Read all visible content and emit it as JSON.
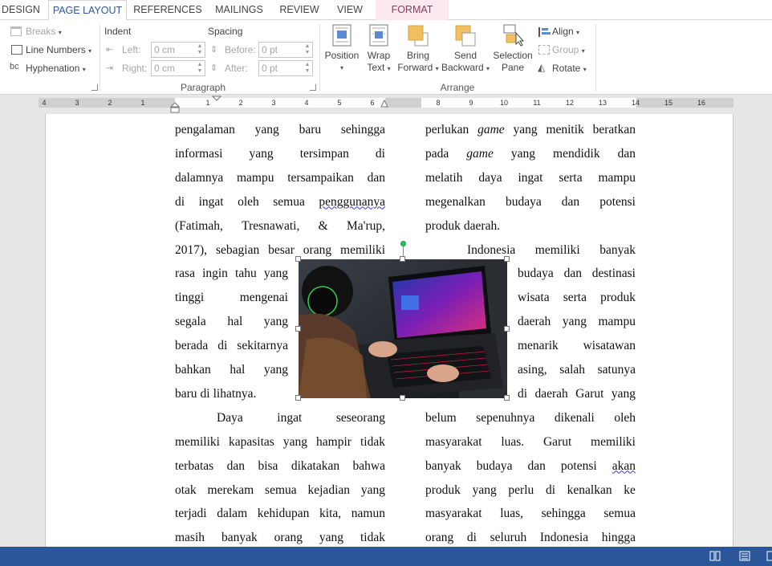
{
  "tabs": [
    {
      "label": "DESIGN"
    },
    {
      "label": "PAGE LAYOUT"
    },
    {
      "label": "REFERENCES"
    },
    {
      "label": "MAILINGS"
    },
    {
      "label": "REVIEW"
    },
    {
      "label": "VIEW"
    },
    {
      "label": "FORMAT"
    }
  ],
  "ribbon": {
    "setup": {
      "breaks": "Breaks",
      "line_numbers": "Line Numbers",
      "hyphenation": "Hyphenation"
    },
    "indent": {
      "title": "Indent",
      "left_label": "Left:",
      "left_value": "0 cm",
      "right_label": "Right:",
      "right_value": "0 cm"
    },
    "spacing": {
      "title": "Spacing",
      "before_label": "Before:",
      "before_value": "0 pt",
      "after_label": "After:",
      "after_value": "0 pt"
    },
    "paragraph_group": "Paragraph",
    "arrange": {
      "position": "Position",
      "wrap_text_1": "Wrap",
      "wrap_text_2": "Text",
      "bring_forward_1": "Bring",
      "bring_forward_2": "Forward",
      "send_backward_1": "Send",
      "send_backward_2": "Backward",
      "selection_pane_1": "Selection",
      "selection_pane_2": "Pane",
      "align": "Align",
      "group": "Group",
      "rotate": "Rotate",
      "group_label": "Arrange"
    }
  },
  "ruler": {
    "numbers": [
      "4",
      "3",
      "2",
      "1",
      "1",
      "2",
      "3",
      "4",
      "5",
      "6",
      "8",
      "9",
      "10",
      "11",
      "12",
      "13",
      "14",
      "15",
      "16"
    ]
  },
  "colors": {
    "accent": "#2b579a",
    "format_tab": "#fbe9ef",
    "rotate_handle": "#22c55e"
  },
  "document": {
    "left_column": [
      [
        "pengalaman",
        "yang",
        "baru",
        "sehingga"
      ],
      [
        "informasi",
        "yang",
        "tersimpan",
        "di"
      ],
      [
        "dalamnya",
        "mampu",
        "tersampaikan",
        "dan"
      ],
      [
        "di",
        "ingat",
        "oleh",
        "semua",
        "penggunanya"
      ],
      [
        "(Fatimah,",
        "Tresnawati,",
        "&",
        "Ma'rup,"
      ],
      [
        "2017),",
        "sebagian",
        "besar",
        "orang",
        "memiliki"
      ],
      [
        "rasa",
        "ingin",
        "tahu",
        "yang"
      ],
      [
        "tinggi",
        "mengenai"
      ],
      [
        "segala",
        "hal",
        "yang"
      ],
      [
        "berada",
        "di",
        "sekitarnya"
      ],
      [
        "bahkan",
        "hal",
        "yang"
      ],
      [
        "baru",
        "di",
        "lihatnya."
      ],
      [
        "Daya",
        "ingat",
        "seseorang"
      ],
      [
        "memiliki",
        "kapasitas",
        "yang",
        "hampir",
        "tidak"
      ],
      [
        "terbatas",
        "dan",
        "bisa",
        "dikatakan",
        "bahwa"
      ],
      [
        "otak",
        "merekam",
        "semua",
        "kejadian",
        "yang"
      ],
      [
        "terjadi",
        "dalam",
        "kehidupan",
        "kita,",
        "namun"
      ],
      [
        "masih",
        "banyak",
        "orang",
        "yang",
        "tidak"
      ]
    ],
    "right_column": [
      [
        "perlukan",
        "game",
        "yang",
        "menitik",
        "beratkan"
      ],
      [
        "pada",
        "game",
        "yang",
        "mendidik",
        "dan"
      ],
      [
        "melatih",
        "daya",
        "ingat",
        "serta",
        "mampu"
      ],
      [
        "megenalkan",
        "budaya",
        "dan",
        "potensi"
      ],
      [
        "produk",
        "daerah."
      ],
      [
        "Indonesia",
        "memiliki",
        "banyak"
      ],
      [
        "budaya",
        "dan",
        "destinasi"
      ],
      [
        "wisata",
        "serta",
        "produk"
      ],
      [
        "daerah",
        "yang",
        "mampu"
      ],
      [
        "menarik",
        "wisatawan"
      ],
      [
        "asing,",
        "salah",
        "satunya"
      ],
      [
        "di",
        "daerah",
        "Garut",
        "yang"
      ],
      [
        "belum",
        "sepenuhnya",
        "dikenali",
        "oleh"
      ],
      [
        "masyarakat",
        "luas.",
        "Garut",
        "memiliki"
      ],
      [
        "banyak",
        "budaya",
        "dan",
        "potensi",
        "akan"
      ],
      [
        "produk",
        "yang",
        "perlu",
        "di",
        "kenalkan",
        "ke"
      ],
      [
        "masyarakat",
        "luas,",
        "sehingga",
        "semua"
      ],
      [
        "orang",
        "di",
        "seluruh",
        "Indonesia",
        "hingga"
      ]
    ]
  }
}
